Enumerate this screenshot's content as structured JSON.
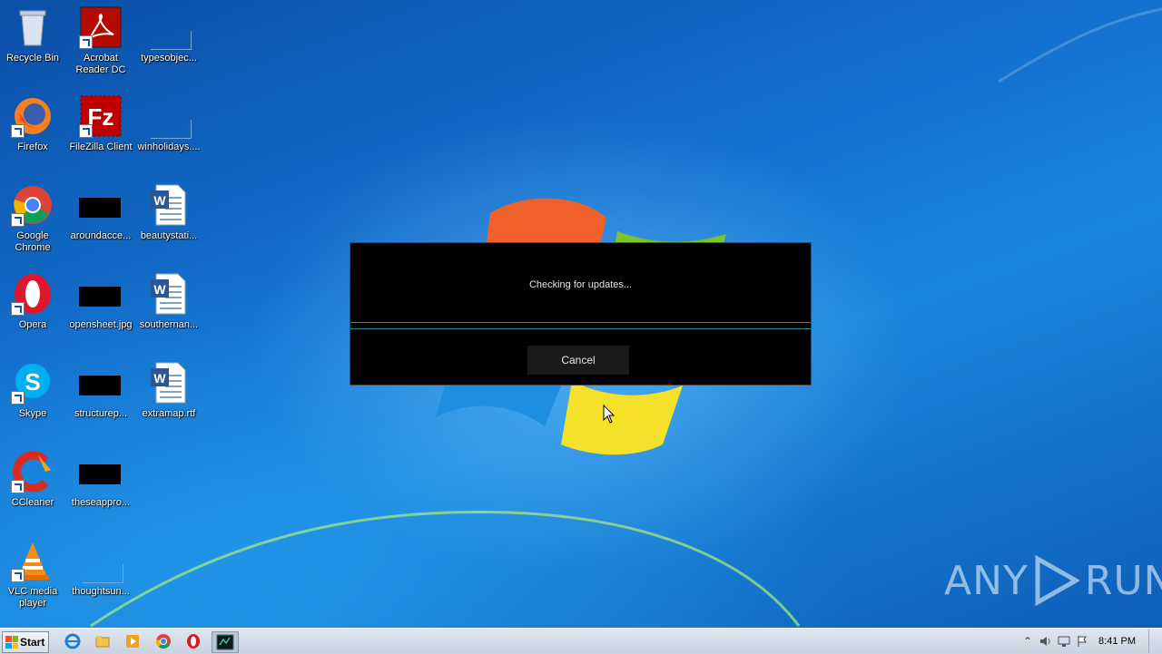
{
  "desktop_icons": [
    {
      "label": "Recycle Bin",
      "icon": "recycle-bin-icon"
    },
    {
      "label": "Acrobat Reader DC",
      "icon": "acrobat-icon"
    },
    {
      "label": "typesobjec...",
      "icon": "blank-file-icon"
    },
    {
      "label": "Firefox",
      "icon": "firefox-icon"
    },
    {
      "label": "FileZilla Client",
      "icon": "filezilla-icon"
    },
    {
      "label": "winholidays....",
      "icon": "blank-file-icon"
    },
    {
      "label": "Google Chrome",
      "icon": "chrome-icon"
    },
    {
      "label": "aroundacce...",
      "icon": "image-file-icon"
    },
    {
      "label": "beautystati...",
      "icon": "word-doc-icon"
    },
    {
      "label": "Opera",
      "icon": "opera-icon"
    },
    {
      "label": "opensheet.jpg",
      "icon": "image-file-icon"
    },
    {
      "label": "southernan...",
      "icon": "word-doc-icon"
    },
    {
      "label": "Skype",
      "icon": "skype-icon"
    },
    {
      "label": "structurep...",
      "icon": "image-file-icon"
    },
    {
      "label": "extramap.rtf",
      "icon": "word-doc-icon"
    },
    {
      "label": "CCleaner",
      "icon": "ccleaner-icon"
    },
    {
      "label": "theseappro...",
      "icon": "image-file-icon"
    },
    {
      "label": "VLC media player",
      "icon": "vlc-icon"
    },
    {
      "label": "thoughtsun...",
      "icon": "blank-file-icon"
    }
  ],
  "dialog": {
    "message": "Checking for updates...",
    "progress": 0,
    "cancel_label": "Cancel"
  },
  "watermark": {
    "left": "ANY",
    "right": "RUN"
  },
  "taskbar": {
    "start_label": "Start",
    "clock": "8:41 PM",
    "pinned": [
      "internet-explorer-icon",
      "file-explorer-icon",
      "media-player-icon",
      "chrome-icon",
      "opera-icon",
      "updater-app-icon"
    ]
  },
  "colors": {
    "dialog_bg": "#000000",
    "progress_border": "#2b8f8f",
    "taskbar": "#d5dde8"
  }
}
